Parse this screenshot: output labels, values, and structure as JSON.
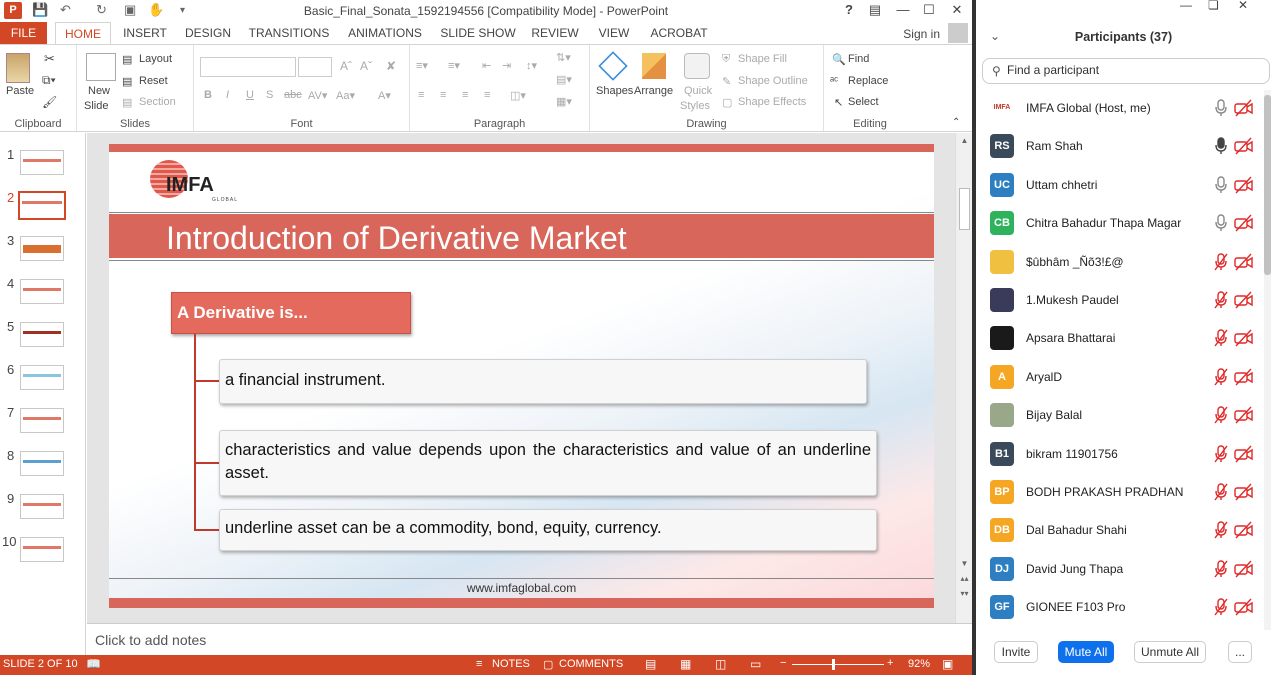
{
  "powerpoint": {
    "app_icon": "P",
    "window_title": "Basic_Final_Sonata_1592194556 [Compatibility Mode] - PowerPoint",
    "tabs": [
      "FILE",
      "HOME",
      "INSERT",
      "DESIGN",
      "TRANSITIONS",
      "ANIMATIONS",
      "SLIDE SHOW",
      "REVIEW",
      "VIEW",
      "ACROBAT"
    ],
    "active_tab": "HOME",
    "sign_in": "Sign in",
    "ribbon": {
      "clipboard": {
        "label": "Clipboard",
        "paste": "Paste"
      },
      "slides": {
        "label": "Slides",
        "new_slide_1": "New",
        "new_slide_2": "Slide",
        "layout": "Layout",
        "reset": "Reset",
        "section": "Section"
      },
      "font": {
        "label": "Font"
      },
      "paragraph": {
        "label": "Paragraph"
      },
      "drawing": {
        "label": "Drawing",
        "shapes": "Shapes",
        "arrange": "Arrange",
        "quick_styles_1": "Quick",
        "quick_styles_2": "Styles",
        "shape_fill": "Shape Fill",
        "shape_outline": "Shape Outline",
        "shape_effects": "Shape Effects"
      },
      "editing": {
        "label": "Editing",
        "find": "Find",
        "replace": "Replace",
        "select": "Select"
      }
    },
    "thumbnails": [
      "1",
      "2",
      "3",
      "4",
      "5",
      "6",
      "7",
      "8",
      "9",
      "10"
    ],
    "active_slide": 2,
    "slide": {
      "logo_text": "IMFA",
      "logo_sub": "GLOBAL",
      "title": "Introduction of Derivative Market",
      "heading_box": "A Derivative is...",
      "items": [
        "a financial instrument.",
        "characteristics and value depends upon the characteristics and value of an underline asset.",
        "underline asset can be a commodity, bond, equity, currency."
      ],
      "footer_url": "www.imfaglobal.com"
    },
    "notes_placeholder": "Click to add notes",
    "status": {
      "slide_info": "SLIDE 2 OF 10",
      "notes": "NOTES",
      "comments": "COMMENTS",
      "zoom": "92%"
    }
  },
  "zoom": {
    "title": "Participants (37)",
    "search_placeholder": "Find a participant",
    "participants": [
      {
        "name": "IMFA Global (Host, me)",
        "initials": "IMFA",
        "color": "#ffffff",
        "mic": "on",
        "video": "off"
      },
      {
        "name": "Ram Shah",
        "initials": "RS",
        "color": "#3b4a5a",
        "mic": "on-dark",
        "video": "off"
      },
      {
        "name": "Uttam chhetri",
        "initials": "UC",
        "color": "#2d7fc1",
        "mic": "on",
        "video": "off"
      },
      {
        "name": "Chitra Bahadur Thapa Magar",
        "initials": "CB",
        "color": "#2eb35c",
        "mic": "on",
        "video": "off"
      },
      {
        "name": "$ûbhâm _Ñõ3!£@",
        "initials": "",
        "color": "#f0c040",
        "mic": "muted",
        "video": "off"
      },
      {
        "name": "1.Mukesh Paudel",
        "initials": "",
        "color": "#3a3a5a",
        "mic": "muted",
        "video": "off"
      },
      {
        "name": "Apsara Bhattarai",
        "initials": "",
        "color": "#1a1a1a",
        "mic": "muted",
        "video": "off"
      },
      {
        "name": "AryalD",
        "initials": "A",
        "color": "#f5a623",
        "mic": "muted",
        "video": "off"
      },
      {
        "name": "Bijay Balal",
        "initials": "",
        "color": "#9aa88a",
        "mic": "muted",
        "video": "off"
      },
      {
        "name": "bikram 11901756",
        "initials": "B1",
        "color": "#3b4a5a",
        "mic": "muted",
        "video": "off"
      },
      {
        "name": "BODH PRAKASH PRADHAN",
        "initials": "BP",
        "color": "#f5a623",
        "mic": "muted",
        "video": "off"
      },
      {
        "name": "Dal Bahadur Shahi",
        "initials": "DB",
        "color": "#f5a623",
        "mic": "muted",
        "video": "off"
      },
      {
        "name": "David Jung Thapa",
        "initials": "DJ",
        "color": "#2d7fc1",
        "mic": "muted",
        "video": "off"
      },
      {
        "name": "GIONEE F103 Pro",
        "initials": "GF",
        "color": "#2d7fc1",
        "mic": "muted",
        "video": "off"
      }
    ],
    "buttons": {
      "invite": "Invite",
      "mute_all": "Mute All",
      "unmute_all": "Unmute All",
      "more": "..."
    }
  }
}
